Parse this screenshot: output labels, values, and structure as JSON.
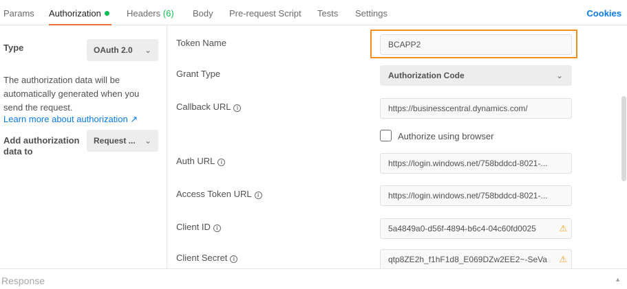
{
  "tabs": [
    {
      "label": "Params"
    },
    {
      "label": "Authorization"
    },
    {
      "label": "Headers",
      "count": "(6)"
    },
    {
      "label": "Body"
    },
    {
      "label": "Pre-request Script"
    },
    {
      "label": "Tests"
    },
    {
      "label": "Settings"
    }
  ],
  "cookies_label": "Cookies",
  "left": {
    "type_label": "Type",
    "type_value": "OAuth 2.0",
    "description": "The authorization data will be automatically generated when you send the request.",
    "learn_more": "Learn more about authorization ↗",
    "add_to_label": "Add authorization data to",
    "add_to_value": "Request ..."
  },
  "fields": {
    "token_name": {
      "label": "Token Name",
      "value": "BCAPP2"
    },
    "grant_type": {
      "label": "Grant Type",
      "value": "Authorization Code"
    },
    "callback_url": {
      "label": "Callback URL",
      "value": "https://businesscentral.dynamics.com/"
    },
    "authorize_browser": {
      "label": "Authorize using browser"
    },
    "auth_url": {
      "label": "Auth URL",
      "value": "https://login.windows.net/758bddcd-8021-..."
    },
    "access_token_url": {
      "label": "Access Token URL",
      "value": "https://login.windows.net/758bddcd-8021-..."
    },
    "client_id": {
      "label": "Client ID",
      "value": "5a4849a0-d56f-4894-b6c4-04c60fd0025"
    },
    "client_secret": {
      "label": "Client Secret",
      "value": "qtp8ZE2h_f1hF1d8_E069DZw2EE2~-SeVa"
    }
  },
  "footer": {
    "label": "Response"
  },
  "colors": {
    "accent": "#f26b3a",
    "link": "#097bed",
    "highlight": "#f28c1b",
    "dot": "#0cbb52"
  }
}
